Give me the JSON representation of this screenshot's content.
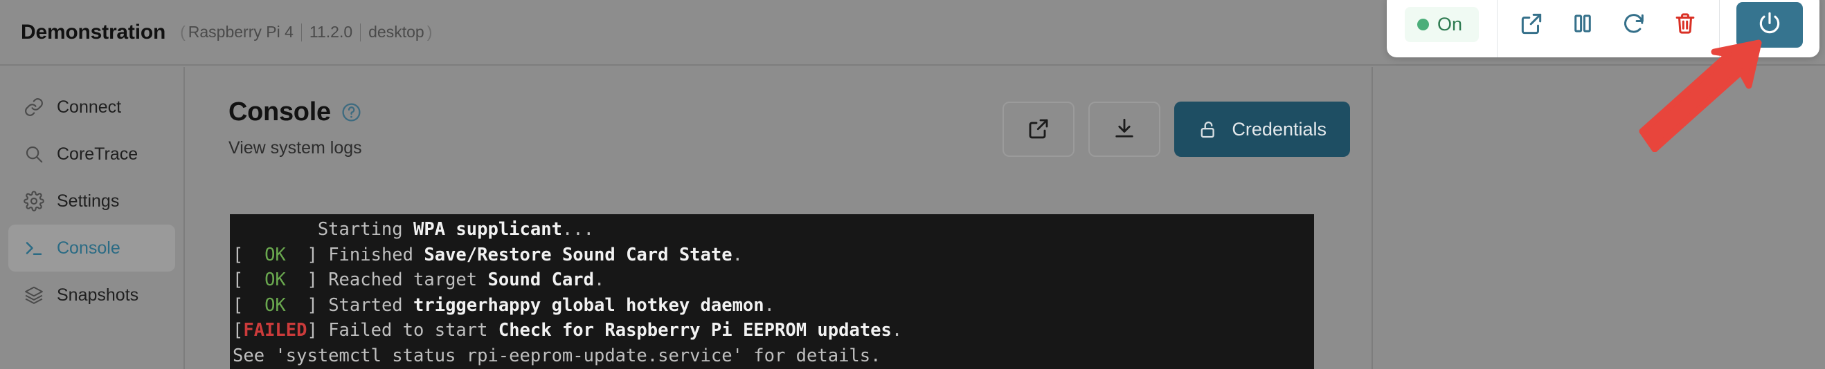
{
  "header": {
    "app_title": "Demonstration",
    "meta_open_paren": "(",
    "meta_close_paren": ")",
    "device_model": "Raspberry Pi 4",
    "os_version": "11.2.0",
    "variant": "desktop"
  },
  "toolbar": {
    "status_label": "On",
    "status_dot_color": "#4cae7a",
    "status_bg_color": "#f0faf3",
    "status_text_color": "#2d7a50",
    "icons": [
      {
        "name": "external-link-icon",
        "title": "Open in new window",
        "color": "#35708a"
      },
      {
        "name": "pause-icon",
        "title": "Pause",
        "color": "#35708a"
      },
      {
        "name": "restart-icon",
        "title": "Restart",
        "color": "#35708a"
      },
      {
        "name": "delete-icon",
        "title": "Delete",
        "color": "#d93025"
      }
    ],
    "power_button": {
      "name": "power-button",
      "title": "Power",
      "bg_color": "#36748f",
      "icon_color": "#ffffff"
    }
  },
  "sidebar": {
    "items": [
      {
        "label": "Connect",
        "icon": "link-icon",
        "active": false
      },
      {
        "label": "CoreTrace",
        "icon": "search-icon",
        "active": false
      },
      {
        "label": "Settings",
        "icon": "gear-icon",
        "active": false
      },
      {
        "label": "Console",
        "icon": "terminal-icon",
        "active": true
      },
      {
        "label": "Snapshots",
        "icon": "layers-icon",
        "active": false
      }
    ],
    "active_color": "#2b6b84"
  },
  "main": {
    "page_title": "Console",
    "help_icon": "help-circle-icon",
    "page_subtitle": "View system logs",
    "actions": [
      {
        "name": "open-external-button",
        "icon": "external-link-icon",
        "label": ""
      },
      {
        "name": "download-logs-button",
        "icon": "download-icon",
        "label": ""
      }
    ],
    "credentials_button": {
      "label": "Credentials",
      "icon": "unlock-icon",
      "bg_color": "#1e4e63"
    }
  },
  "console_log": {
    "lines": [
      {
        "status": "",
        "segments": [
          {
            "text": "        Starting ",
            "style": "dim"
          },
          {
            "text": "WPA supplicant",
            "style": "bold"
          },
          {
            "text": "...",
            "style": "dim"
          }
        ]
      },
      {
        "status": "OK",
        "segments": [
          {
            "text": " Finished ",
            "style": "dim"
          },
          {
            "text": "Save/Restore Sound Card State",
            "style": "bold"
          },
          {
            "text": ".",
            "style": "dim"
          }
        ]
      },
      {
        "status": "OK",
        "segments": [
          {
            "text": " Reached target ",
            "style": "dim"
          },
          {
            "text": "Sound Card",
            "style": "bold"
          },
          {
            "text": ".",
            "style": "dim"
          }
        ]
      },
      {
        "status": "OK",
        "segments": [
          {
            "text": " Started ",
            "style": "dim"
          },
          {
            "text": "triggerhappy global hotkey daemon",
            "style": "bold"
          },
          {
            "text": ".",
            "style": "dim"
          }
        ]
      },
      {
        "status": "FAILED",
        "segments": [
          {
            "text": " Failed to start ",
            "style": "dim"
          },
          {
            "text": "Check for Raspberry Pi EEPROM updates",
            "style": "bold"
          },
          {
            "text": ".",
            "style": "dim"
          }
        ]
      },
      {
        "status": "",
        "segments": [
          {
            "text": "See 'systemctl status rpi-eeprom-update.service' for details.",
            "style": "dim"
          }
        ]
      }
    ],
    "ok_color": "#6aa84f",
    "failed_color": "#cc3b3b",
    "background": "#171717"
  },
  "annotation": {
    "arrow_color": "#e8453c",
    "points_to": "power-button"
  }
}
